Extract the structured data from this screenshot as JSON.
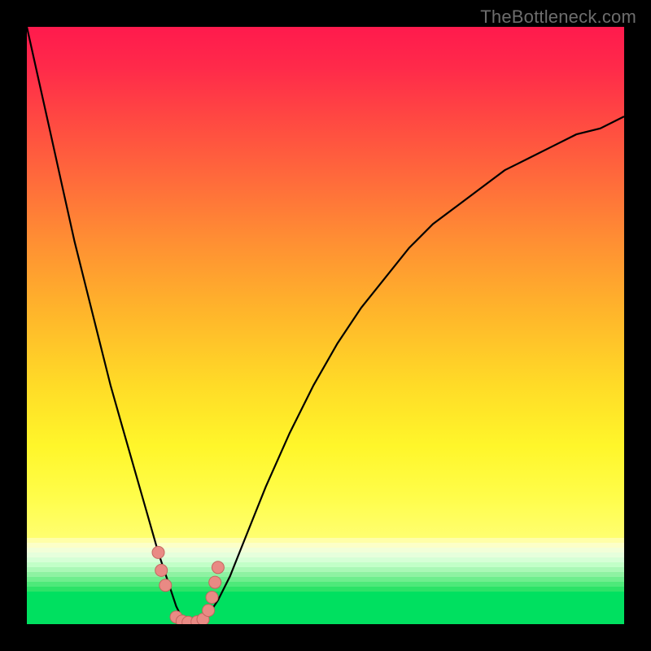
{
  "watermark": "TheBottleneck.com",
  "colors": {
    "black": "#000000",
    "curve": "#000000",
    "marker_fill": "#e98a84",
    "marker_stroke": "#c4655f",
    "green_bottom": "#00e060"
  },
  "chart_data": {
    "type": "line",
    "title": "",
    "xlabel": "",
    "ylabel": "",
    "xlim": [
      0,
      100
    ],
    "ylim": [
      0,
      100
    ],
    "x": [
      0,
      2,
      4,
      6,
      8,
      10,
      12,
      14,
      16,
      18,
      20,
      22,
      23,
      24,
      25,
      26,
      27,
      28,
      29,
      30,
      32,
      34,
      36,
      38,
      40,
      44,
      48,
      52,
      56,
      60,
      64,
      68,
      72,
      76,
      80,
      84,
      88,
      92,
      96,
      100
    ],
    "values": [
      100,
      91,
      82,
      73,
      64,
      56,
      48,
      40,
      33,
      26,
      19,
      12,
      9,
      6,
      3,
      1,
      0,
      0,
      0,
      1,
      4,
      8,
      13,
      18,
      23,
      32,
      40,
      47,
      53,
      58,
      63,
      67,
      70,
      73,
      76,
      78,
      80,
      82,
      83,
      85
    ],
    "valley_x": 27,
    "markers": [
      {
        "x": 22.0,
        "y": 12.0
      },
      {
        "x": 22.5,
        "y": 9.0
      },
      {
        "x": 23.2,
        "y": 6.5
      },
      {
        "x": 25.0,
        "y": 1.2
      },
      {
        "x": 26.0,
        "y": 0.5
      },
      {
        "x": 27.0,
        "y": 0.3
      },
      {
        "x": 28.5,
        "y": 0.4
      },
      {
        "x": 29.5,
        "y": 0.8
      },
      {
        "x": 30.4,
        "y": 2.3
      },
      {
        "x": 31.0,
        "y": 4.5
      },
      {
        "x": 31.5,
        "y": 7.0
      },
      {
        "x": 32.0,
        "y": 9.5
      }
    ]
  },
  "bands": [
    {
      "h": 6,
      "c": "#ffffa8"
    },
    {
      "h": 6,
      "c": "#fcffc8"
    },
    {
      "h": 6,
      "c": "#f2ffd8"
    },
    {
      "h": 6,
      "c": "#e6ffdc"
    },
    {
      "h": 6,
      "c": "#d6ffd6"
    },
    {
      "h": 6,
      "c": "#c2ffc8"
    },
    {
      "h": 6,
      "c": "#aaf8b6"
    },
    {
      "h": 6,
      "c": "#8ef2a2"
    },
    {
      "h": 6,
      "c": "#6fee8e"
    },
    {
      "h": 6,
      "c": "#4ee97a"
    },
    {
      "h": 6,
      "c": "#2de368"
    },
    {
      "h": 40,
      "c": "#00e060"
    }
  ]
}
